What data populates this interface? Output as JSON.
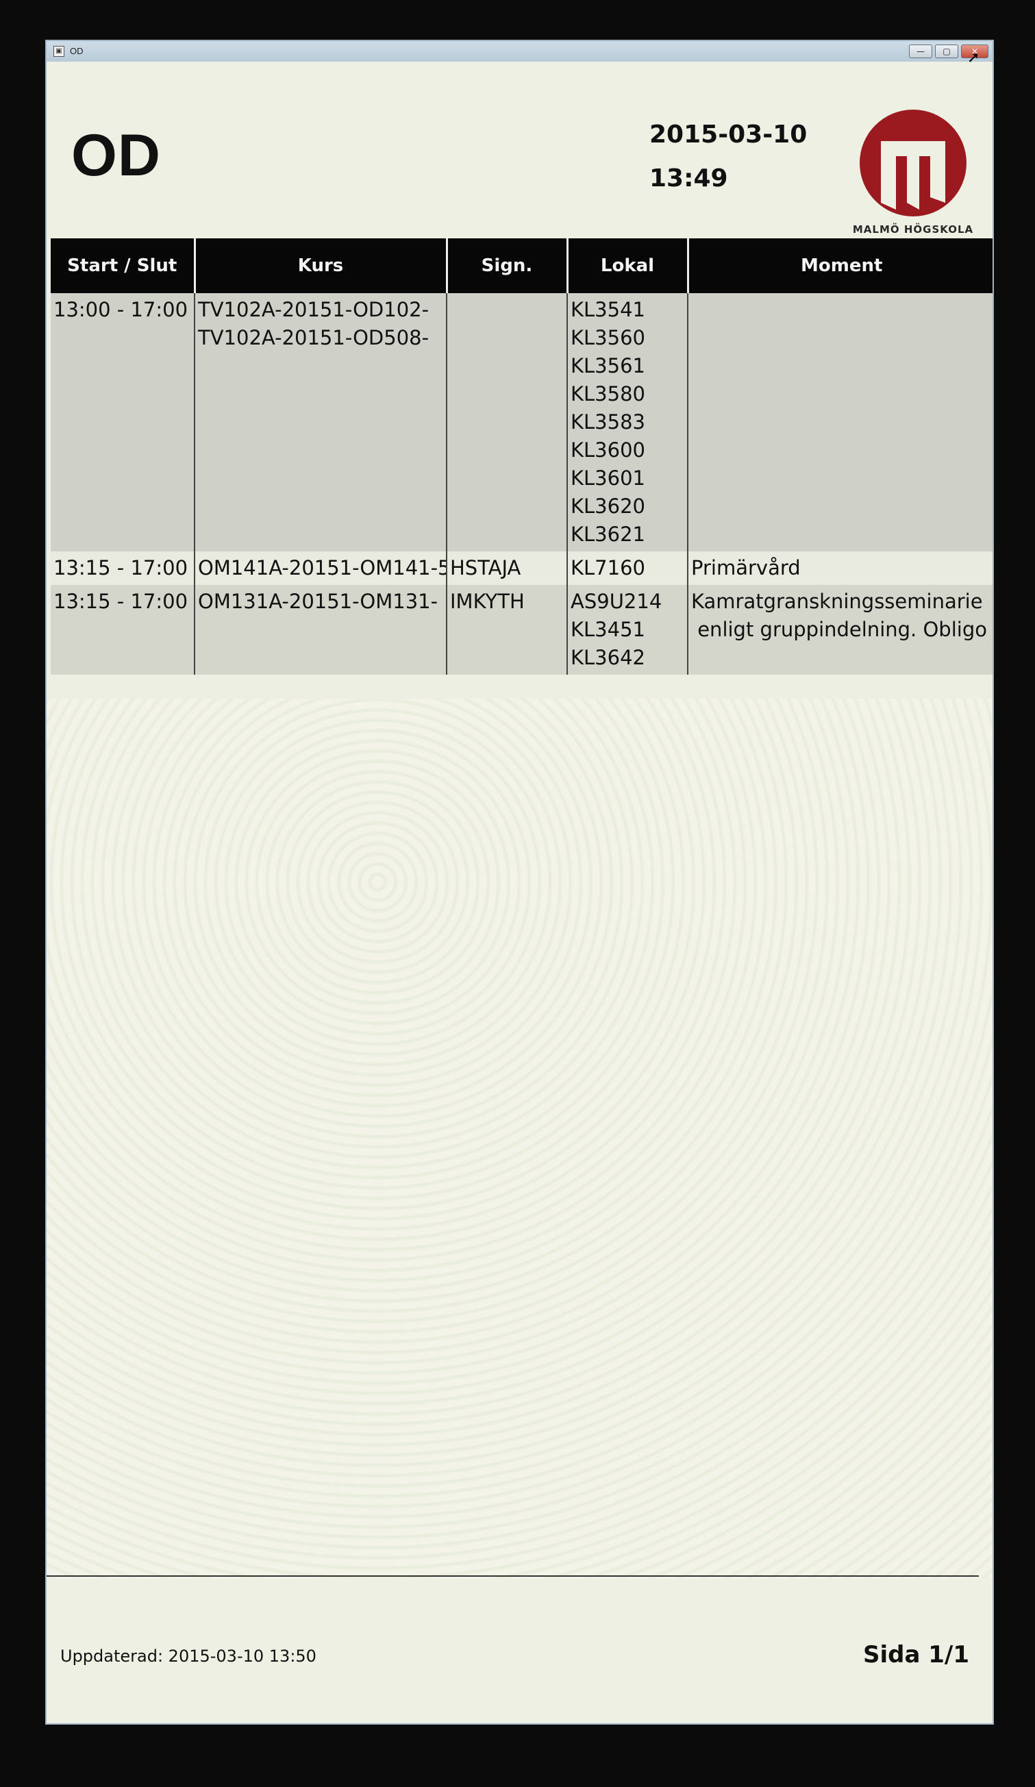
{
  "window": {
    "title": "OD",
    "controls": {
      "minimize": "—",
      "maximize": "▢",
      "close": "✕"
    }
  },
  "header": {
    "room": "OD",
    "date": "2015-03-10",
    "time": "13:49",
    "logo_text": "MALMÖ HÖGSKOLA",
    "logo_color": "#9b1a20"
  },
  "table": {
    "columns": [
      "Start / Slut",
      "Kurs",
      "Sign.",
      "Lokal",
      "Moment"
    ],
    "rows": [
      {
        "time": "13:00 - 17:00",
        "kurs": [
          "TV102A-20151-OD102-",
          "TV102A-20151-OD508-"
        ],
        "sign": "",
        "lokal": [
          "KL3541",
          "KL3560",
          "KL3561",
          "KL3580",
          "KL3583",
          "KL3600",
          "KL3601",
          "KL3620",
          "KL3621"
        ],
        "moment": ""
      },
      {
        "time": "13:15 - 17:00",
        "kurs": [
          "OM141A-20151-OM141-5"
        ],
        "sign": "HSTAJA",
        "lokal": [
          "KL7160"
        ],
        "moment": "Primärvård"
      },
      {
        "time": "13:15 - 17:00",
        "kurs": [
          "OM131A-20151-OM131-"
        ],
        "sign": "IMKYTH",
        "lokal": [
          "AS9U214",
          "KL3451",
          "KL3642"
        ],
        "moment": "Kamratgranskningsseminarie\n enligt gruppindelning. Obligo"
      }
    ]
  },
  "footer": {
    "updated": "Uppdaterad: 2015-03-10 13:50",
    "page": "Sida 1/1"
  }
}
